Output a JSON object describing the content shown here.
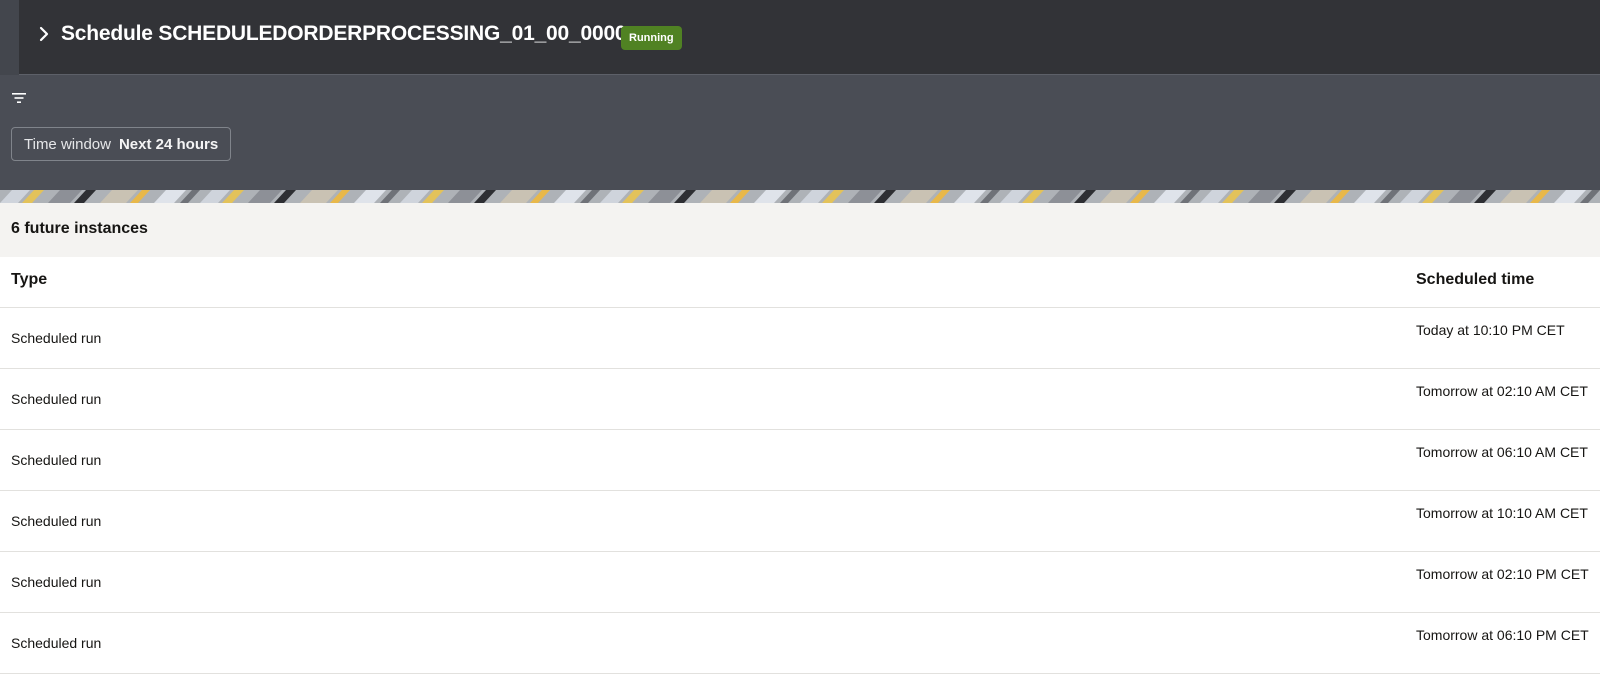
{
  "header": {
    "title": "Schedule SCHEDULEDORDERPROCESSING_01_00_0000",
    "status": "Running",
    "status_color": "#508223",
    "expand_icon": "chevron-right-icon"
  },
  "filters": {
    "filter_icon": "filter-icon",
    "time_window_label": "Time window",
    "time_window_value": "Next 24 hours"
  },
  "results": {
    "count_text": "6 future instances",
    "columns": [
      "Type",
      "Scheduled time"
    ],
    "rows": [
      {
        "type": "Scheduled run",
        "time": "Today at 10:10 PM CET"
      },
      {
        "type": "Scheduled run",
        "time": "Tomorrow at 02:10 AM CET"
      },
      {
        "type": "Scheduled run",
        "time": "Tomorrow at 06:10 AM CET"
      },
      {
        "type": "Scheduled run",
        "time": "Tomorrow at 10:10 AM CET"
      },
      {
        "type": "Scheduled run",
        "time": "Tomorrow at 02:10 PM CET"
      },
      {
        "type": "Scheduled run",
        "time": "Tomorrow at 06:10 PM CET"
      }
    ]
  }
}
